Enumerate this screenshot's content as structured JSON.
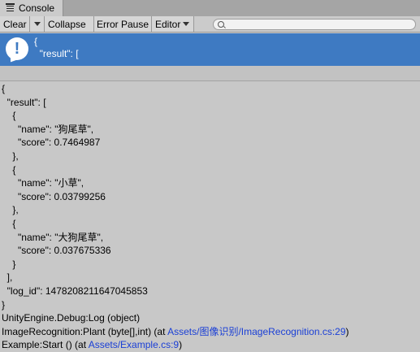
{
  "window": {
    "tab_label": "Console",
    "tab_icon": "console-list-icon"
  },
  "toolbar": {
    "clear": "Clear",
    "collapse": "Collapse",
    "error_pause": "Error Pause",
    "editor": "Editor",
    "search_placeholder": ""
  },
  "selected_entry": {
    "icon": "info-icon",
    "line1": "{",
    "line2": "  \"result\": ["
  },
  "detail": {
    "json_lines": [
      "{",
      "  \"result\": [",
      "    {",
      "      \"name\": \"狗尾草\",",
      "      \"score\": 0.7464987",
      "    },",
      "    {",
      "      \"name\": \"小草\",",
      "      \"score\": 0.03799256",
      "    },",
      "    {",
      "      \"name\": \"大狗尾草\",",
      "      \"score\": 0.037675336",
      "    }",
      "  ],",
      "  \"log_id\": 1478208211647045853",
      "}"
    ],
    "stack": {
      "line1": "UnityEngine.Debug:Log (object)",
      "line2_prefix": "ImageRecognition:Plant (byte[],int) (at ",
      "line2_link": "Assets/图像识别/ImageRecognition.cs:29",
      "line2_suffix": ")",
      "line3_prefix": "Example:Start () (at ",
      "line3_link": "Assets/Example.cs:9",
      "line3_suffix": ")"
    }
  }
}
